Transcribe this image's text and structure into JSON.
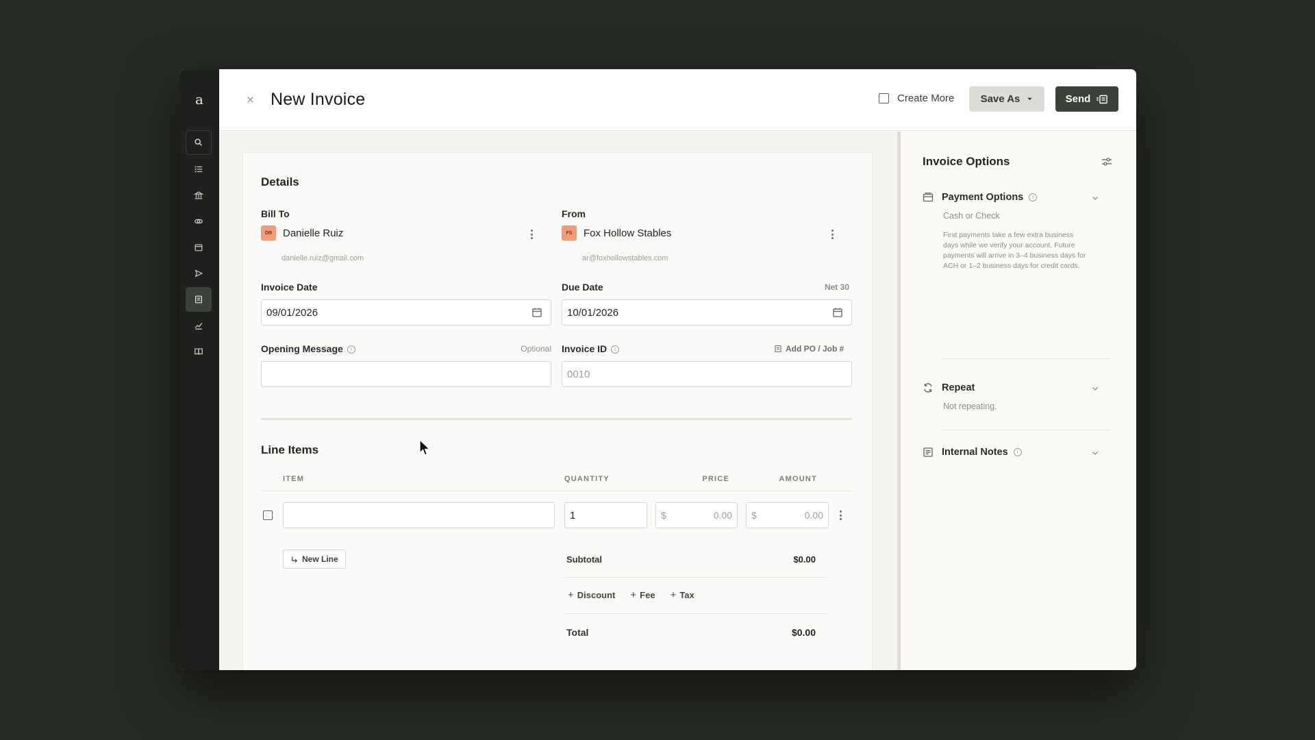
{
  "app": {
    "logo": "a"
  },
  "header": {
    "title": "New Invoice",
    "create_more_label": "Create More",
    "save_as_label": "Save As",
    "send_label": "Send"
  },
  "details": {
    "section_title": "Details",
    "bill_to": {
      "label": "Bill To",
      "initials": "DR",
      "name": "Danielle Ruiz",
      "email": "danielle.ruiz@gmail.com"
    },
    "from": {
      "label": "From",
      "initials": "FS",
      "name": "Fox Hollow Stables",
      "email": "ar@foxhollowstables.com"
    },
    "invoice_date": {
      "label": "Invoice Date",
      "value": "09/01/2026"
    },
    "due_date": {
      "label": "Due Date",
      "value": "10/01/2026",
      "terms": "Net 30"
    },
    "opening_message": {
      "label": "Opening Message",
      "optional": "Optional",
      "value": ""
    },
    "invoice_id": {
      "label": "Invoice ID",
      "placeholder": "0010",
      "add_po": "Add PO / Job #"
    }
  },
  "line_items": {
    "section_title": "Line Items",
    "columns": [
      "ITEM",
      "QUANTITY",
      "PRICE",
      "AMOUNT"
    ],
    "rows": [
      {
        "item": "",
        "quantity": "1",
        "price_currency": "$",
        "price": "0.00",
        "amount_currency": "$",
        "amount": "0.00"
      }
    ],
    "new_line_label": "New Line",
    "subtotal_label": "Subtotal",
    "subtotal_value": "$0.00",
    "adjustments": [
      "Discount",
      "Fee",
      "Tax"
    ],
    "total_label": "Total",
    "total_value": "$0.00"
  },
  "invoice_options": {
    "title": "Invoice Options",
    "payment_options": {
      "label": "Payment Options",
      "value": "Cash or Check",
      "note": "First payments take a few extra business days while we verify your account. Future payments will arrive in 3–4 business days for ACH or 1–2 business days for credit cards."
    },
    "repeat": {
      "label": "Repeat",
      "value": "Not repeating."
    },
    "internal_notes": {
      "label": "Internal Notes"
    }
  },
  "colors": {
    "rail_bg": "#1e211d",
    "primary_button": "#3c4239",
    "secondary_button": "#dddcd6",
    "avatar": "#f19b78",
    "page_bg": "#262a24"
  }
}
